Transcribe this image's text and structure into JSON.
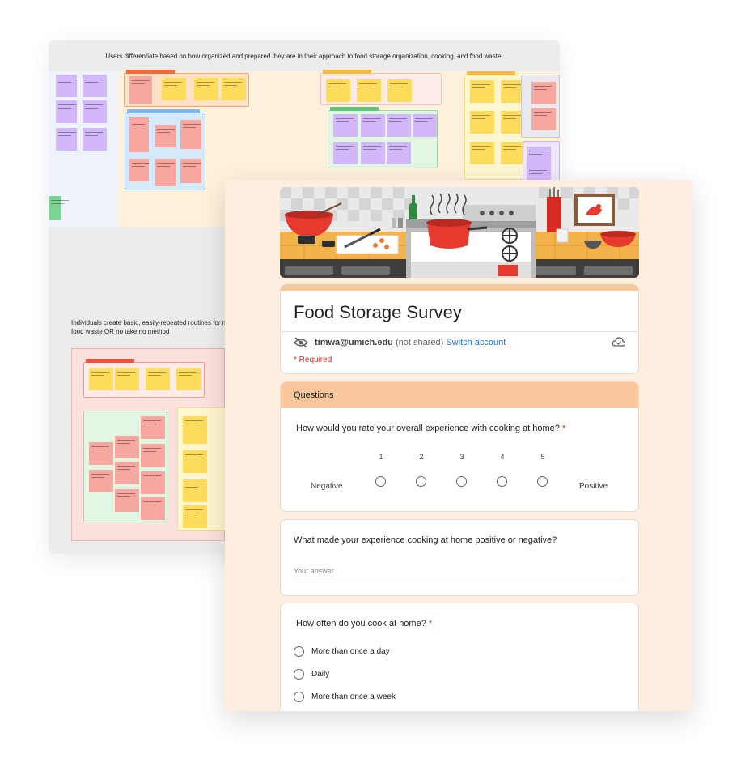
{
  "board": {
    "title_top": "Users differentiate based on how organized and prepared they are in their approach to food storage organization, cooking, and food waste.",
    "title_bottom": "Individuals create basic, easily-repeated routines for mitigating food waste OR no take no method"
  },
  "form": {
    "title": "Food Storage Survey",
    "account_email": "timwa@umich.edu",
    "not_shared": "(not shared)",
    "switch_account": "Switch account",
    "required_note": "* Required",
    "icons": {
      "privacy": "eye-slash-icon",
      "cloud": "cloud-check-icon"
    }
  },
  "section": {
    "title": "Questions",
    "question1": {
      "text": "How would you rate your overall experience with cooking at home?",
      "required_mark": "*",
      "scale": [
        "1",
        "2",
        "3",
        "4",
        "5"
      ],
      "low_label": "Negative",
      "high_label": "Positive"
    }
  },
  "question2": {
    "text": "What made your experience cooking at home positive or negative?",
    "placeholder": "Your answer"
  },
  "question3": {
    "text": "How often do you cook at home?",
    "required_mark": "*",
    "options": [
      "More than once a day",
      "Daily",
      "More than once a week"
    ]
  },
  "colors": {
    "accent": "#f9c79b",
    "survey_bg": "#fdeee0",
    "required": "#d93025",
    "link": "#1a73e8",
    "note_purple": "#d2b7fb",
    "note_yellow": "#fddc5c",
    "note_pink": "#f8a7a0",
    "note_green": "#7cd394"
  }
}
